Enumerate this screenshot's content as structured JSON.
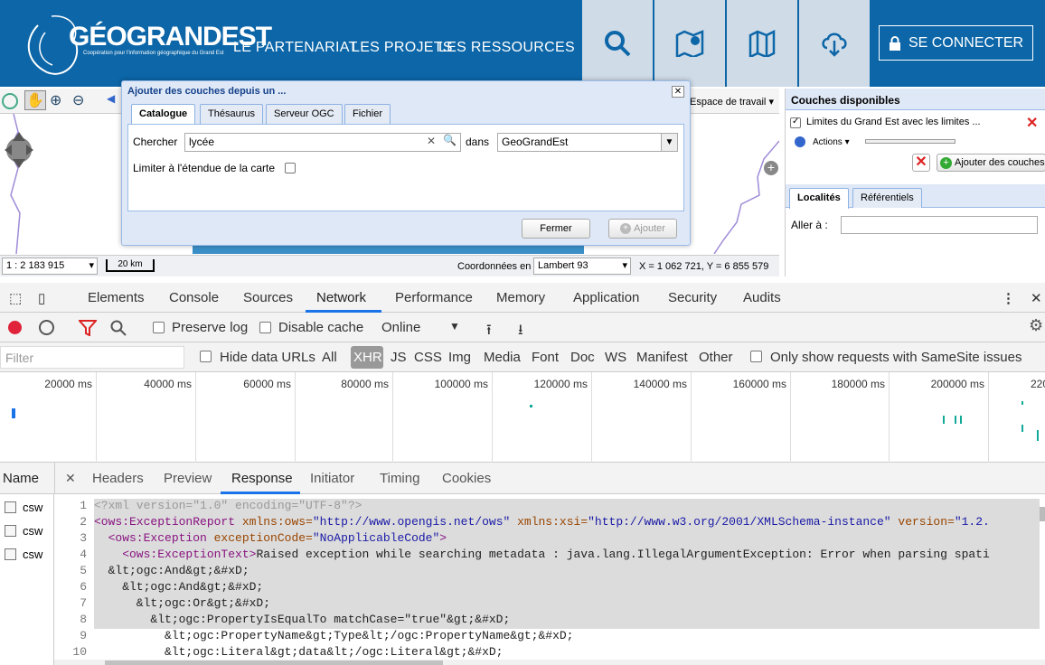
{
  "header": {
    "logo": "GÉOGRANDEST",
    "logo_sub": "Coopération pour l'information géographique du Grand Est",
    "nav": [
      "LE PARTENARIAT",
      "LES PROJETS",
      "LES RESSOURCES"
    ],
    "login": "SE CONNECTER",
    "accent": "#0c66a8"
  },
  "map": {
    "workspace": "Espace de travail",
    "scale": "1 : 2 183 915",
    "scalebar": "20 km",
    "coord_label": "Coordonnées en",
    "coord_system": "Lambert 93",
    "coords": "X = 1 062 721, Y = 6 855 579"
  },
  "dialog": {
    "title": "Ajouter des couches depuis un ...",
    "tabs": [
      "Catalogue",
      "Thésaurus",
      "Serveur OGC",
      "Fichier"
    ],
    "search_label": "Chercher",
    "search_value": "lycée",
    "in_label": "dans",
    "source": "GeoGrandEst",
    "limit_label": "Limiter à l'étendue de la carte",
    "close_btn": "Fermer",
    "add_btn": "Ajouter"
  },
  "right_panel": {
    "title": "Couches disponibles",
    "layer": "Limites du Grand Est avec les limites ...",
    "actions": "Actions",
    "add_layers": "Ajouter des couches",
    "tabs": [
      "Localités",
      "Référentiels"
    ],
    "goto": "Aller à :"
  },
  "devtools": {
    "tabs": [
      "Elements",
      "Console",
      "Sources",
      "Network",
      "Performance",
      "Memory",
      "Application",
      "Security",
      "Audits"
    ],
    "preserve_log": "Preserve log",
    "disable_cache": "Disable cache",
    "throttle": "Online",
    "filter_placeholder": "Filter",
    "hide_data": "Hide data URLs",
    "types": [
      "All",
      "XHR",
      "JS",
      "CSS",
      "Img",
      "Media",
      "Font",
      "Doc",
      "WS",
      "Manifest",
      "Other"
    ],
    "samesite": "Only show requests with SameSite issues",
    "timeline": [
      "20000 ms",
      "40000 ms",
      "60000 ms",
      "80000 ms",
      "100000 ms",
      "120000 ms",
      "140000 ms",
      "160000 ms",
      "180000 ms",
      "200000 ms",
      "220"
    ],
    "name_header": "Name",
    "req_tabs": [
      "Headers",
      "Preview",
      "Response",
      "Initiator",
      "Timing",
      "Cookies"
    ],
    "requests": [
      "csw",
      "csw",
      "csw"
    ]
  },
  "code": {
    "numbers": [
      "1",
      "2",
      "3",
      "4",
      "5",
      "6",
      "7",
      "8",
      "9",
      "10"
    ],
    "l1": "<?xml version=\"1.0\" encoding=\"UTF-8\"?>",
    "l2a": "<ows:ExceptionReport",
    "l2b": " xmlns:ows=",
    "l2c": "\"http://www.opengis.net/ows\"",
    "l2d": " xmlns:xsi=",
    "l2e": "\"http://www.w3.org/2001/XMLSchema-instance\"",
    "l2f": " version=",
    "l2g": "\"1.2.",
    "l3a": "  <ows:Exception",
    "l3b": " exceptionCode=",
    "l3c": "\"NoApplicableCode\"",
    "l3d": ">",
    "l4a": "    <ows:ExceptionText>",
    "l4b": "Raised exception while searching metadata : java.lang.IllegalArgumentException: Error when parsing spati",
    "l5": "  &lt;ogc:And&gt;&#xD;",
    "l6": "    &lt;ogc:And&gt;&#xD;",
    "l7": "      &lt;ogc:Or&gt;&#xD;",
    "l8": "        &lt;ogc:PropertyIsEqualTo matchCase=\"true\"&gt;&#xD;",
    "l9": "          &lt;ogc:PropertyName&gt;Type&lt;/ogc:PropertyName&gt;&#xD;",
    "l10": "          &lt;ogc:Literal&gt;data&lt;/ogc:Literal&gt;&#xD;"
  }
}
